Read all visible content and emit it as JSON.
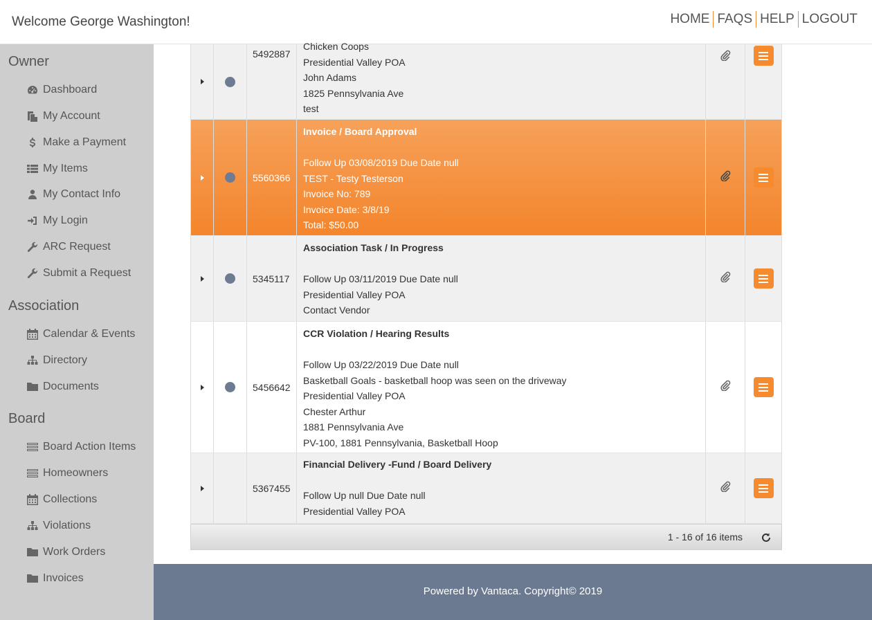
{
  "header": {
    "welcome": "Welcome George Washington!",
    "nav": [
      "HOME",
      "FAQS",
      "HELP",
      "LOGOUT"
    ]
  },
  "sidebar": {
    "sections": [
      {
        "title": "Owner",
        "items": [
          {
            "label": "Dashboard",
            "icon": "dashboard-icon"
          },
          {
            "label": "My Account",
            "icon": "copy-icon"
          },
          {
            "label": "Make a Payment",
            "icon": "dollar-icon"
          },
          {
            "label": "My Items",
            "icon": "list-icon"
          },
          {
            "label": "My Contact Info",
            "icon": "user-icon"
          },
          {
            "label": "My Login",
            "icon": "sign-in-icon"
          },
          {
            "label": "ARC Request",
            "icon": "wrench-icon"
          },
          {
            "label": "Submit a Request",
            "icon": "wrench-icon"
          }
        ]
      },
      {
        "title": "Association",
        "items": [
          {
            "label": "Calendar & Events",
            "icon": "calendar-icon"
          },
          {
            "label": "Directory",
            "icon": "sitemap-icon"
          },
          {
            "label": "Documents",
            "icon": "folder-icon"
          }
        ]
      },
      {
        "title": "Board",
        "items": [
          {
            "label": "Board Action Items",
            "icon": "tasks-icon"
          },
          {
            "label": "Homeowners",
            "icon": "tasks-icon"
          },
          {
            "label": "Collections",
            "icon": "calendar-icon"
          },
          {
            "label": "Violations",
            "icon": "sitemap-icon"
          },
          {
            "label": "Work Orders",
            "icon": "folder-icon"
          },
          {
            "label": "Invoices",
            "icon": "folder-icon"
          }
        ]
      }
    ]
  },
  "grid": {
    "rows": [
      {
        "id": "5492887",
        "has_dot": true,
        "selected": false,
        "title": "",
        "lines": [
          "Chicken Coops",
          "Presidential Valley POA",
          "John Adams",
          "1825 Pennsylvania Ave",
          "test"
        ]
      },
      {
        "id": "5560366",
        "has_dot": true,
        "selected": true,
        "title": "Invoice / Board Approval",
        "lines": [
          "",
          "Follow Up 03/08/2019 Due Date null",
          "TEST - Testy Testerson",
          "Invoice No: 789",
          "Invoice Date: 3/8/19",
          "Total: $50.00"
        ]
      },
      {
        "id": "5345117",
        "has_dot": true,
        "selected": false,
        "title": "Association Task / In Progress",
        "lines": [
          "",
          "Follow Up 03/11/2019 Due Date null",
          "Presidential Valley POA",
          "Contact Vendor"
        ]
      },
      {
        "id": "5456642",
        "has_dot": true,
        "selected": false,
        "title": "CCR Violation / Hearing Results",
        "lines": [
          "",
          "Follow Up 03/22/2019 Due Date null",
          "Basketball Goals - basketball hoop was seen on the driveway",
          "Presidential Valley POA",
          "Chester Arthur",
          "1881 Pennsylvania Ave",
          "PV-100, 1881 Pennsylvania, Basketball Hoop"
        ]
      },
      {
        "id": "5367455",
        "has_dot": false,
        "selected": false,
        "title": "Financial Delivery -Fund / Board Delivery",
        "lines": [
          "",
          "Follow Up null Due Date null",
          "Presidential Valley POA"
        ]
      }
    ],
    "pager_text": "1 - 16 of 16 items"
  },
  "footer": {
    "text": "Powered by Vantaca. Copyright© 2019"
  },
  "colors": {
    "accent": "#f58a2f",
    "sidebar_bg": "#cecece",
    "footer_bg": "#6b7a91",
    "dot": "#6e7c93"
  }
}
